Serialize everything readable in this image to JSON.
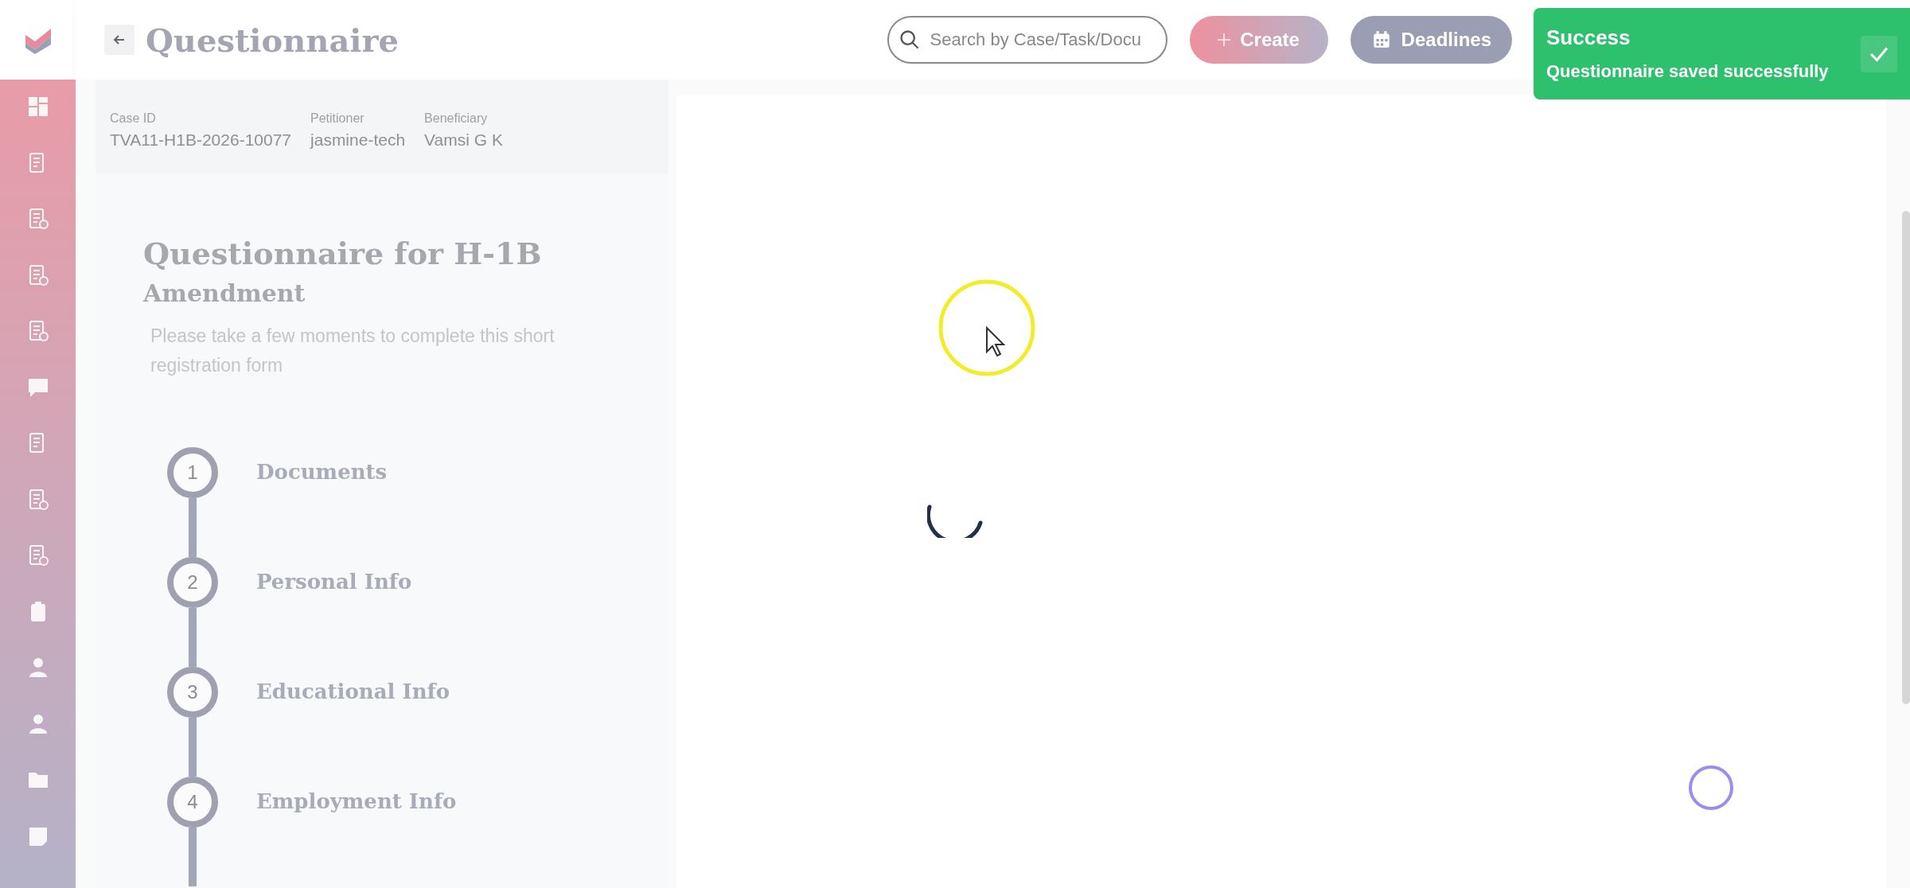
{
  "header": {
    "title": "Questionnaire",
    "search": {
      "placeholder": "Search by Case/Task/Docu"
    },
    "buttons": [
      {
        "kind": "create",
        "label": "Create"
      },
      {
        "kind": "deadlines",
        "label": "Deadlines"
      }
    ]
  },
  "toast": {
    "title": "Success",
    "message": "Questionnaire saved successfully"
  },
  "case_info": [
    {
      "label": "Case ID",
      "value": "TVA11-H1B-2026-10077"
    },
    {
      "label": "Petitioner",
      "value": "jasmine-tech"
    },
    {
      "label": "Beneficiary",
      "value": "Vamsi G K"
    }
  ],
  "form": {
    "title": "Questionnaire for H-1B",
    "subtitle": "Amendment",
    "description": "Please take a few moments to complete this short registration form"
  },
  "steps": [
    {
      "number": "1",
      "label": "Documents"
    },
    {
      "number": "2",
      "label": "Personal Info"
    },
    {
      "number": "3",
      "label": "Educational Info"
    },
    {
      "number": "4",
      "label": "Employment Info"
    }
  ]
}
